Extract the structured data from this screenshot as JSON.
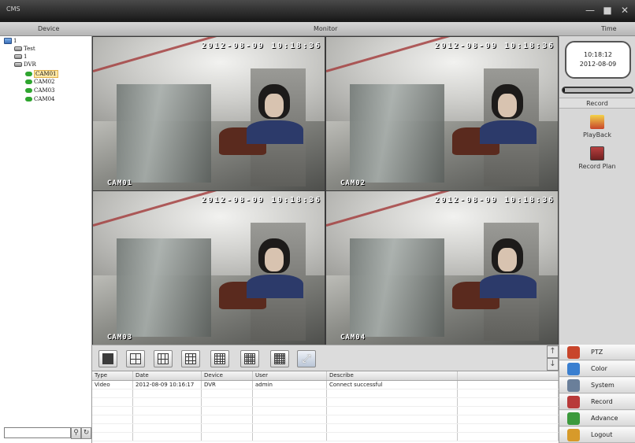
{
  "window": {
    "title": "CMS"
  },
  "header": {
    "device": "Device",
    "monitor": "Monitor",
    "time": "Time"
  },
  "tree": {
    "items": [
      {
        "label": "1",
        "icon": "root-icon"
      },
      {
        "label": "Test",
        "icon": "device-icon"
      },
      {
        "label": "1",
        "icon": "device-icon"
      },
      {
        "label": "DVR",
        "icon": "device-icon"
      },
      {
        "label": "CAM01",
        "icon": "camera-icon",
        "selected": true
      },
      {
        "label": "CAM02",
        "icon": "camera-icon"
      },
      {
        "label": "CAM03",
        "icon": "camera-icon"
      },
      {
        "label": "CAM04",
        "icon": "camera-icon"
      }
    ],
    "search_value": ""
  },
  "panes": [
    {
      "timestamp": "2012-08-09 10:18:36",
      "camera": "CAM01",
      "active": true
    },
    {
      "timestamp": "2012-08-09 10:18:36",
      "camera": "CAM02"
    },
    {
      "timestamp": "2012-08-09 10:18:36",
      "camera": "CAM03"
    },
    {
      "timestamp": "2012-08-09 10:18:36",
      "camera": "CAM04"
    }
  ],
  "right": {
    "clock_time": "10:18:12",
    "clock_date": "2012-08-09",
    "progress": 0.02,
    "record_title": "Record",
    "playback": "PlayBack",
    "record_plan": "Record Plan"
  },
  "log": {
    "headers": [
      "Type",
      "Date",
      "Device",
      "User",
      "Describe",
      ""
    ],
    "rows": [
      [
        "Video",
        "2012-08-09 10:16:17",
        "DVR",
        "admin",
        "Connect successful",
        ""
      ]
    ]
  },
  "menu": {
    "items": [
      {
        "label": "PTZ",
        "color": "#c8452b"
      },
      {
        "label": "Color",
        "color": "#3a7fd0"
      },
      {
        "label": "System",
        "color": "#6a7f9a"
      },
      {
        "label": "Record",
        "color": "#b83a3a"
      },
      {
        "label": "Advance",
        "color": "#3c9a3c"
      },
      {
        "label": "Logout",
        "color": "#d79a2a"
      }
    ]
  }
}
